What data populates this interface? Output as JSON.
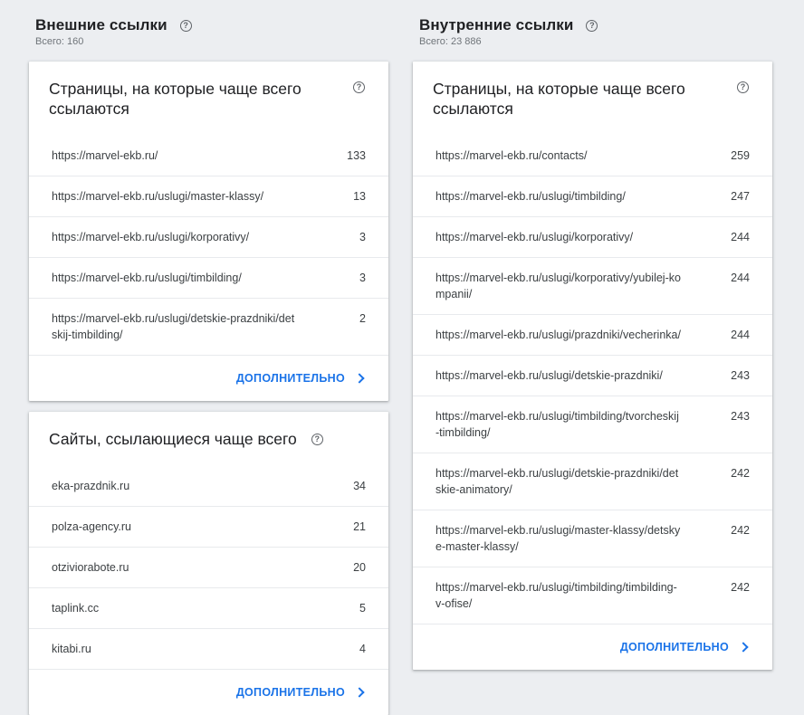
{
  "external": {
    "title": "Внешние ссылки",
    "total": "Всего: 160",
    "top_pages": {
      "title": "Страницы, на которые чаще всего ссылаются",
      "rows": [
        {
          "url": "https://marvel-ekb.ru/",
          "count": "133"
        },
        {
          "url": "https://marvel-ekb.ru/uslugi/master-klassy/",
          "count": "13"
        },
        {
          "url": "https://marvel-ekb.ru/uslugi/korporativy/",
          "count": "3"
        },
        {
          "url": "https://marvel-ekb.ru/uslugi/timbilding/",
          "count": "3"
        },
        {
          "url": "https://marvel-ekb.ru/uslugi/detskie-prazdniki/detskij-timbilding/",
          "count": "2"
        }
      ],
      "more_label": "ДОПОЛНИТЕЛЬНО"
    },
    "top_sites": {
      "title": "Сайты, ссылающиеся чаще всего",
      "rows": [
        {
          "url": "eka-prazdnik.ru",
          "count": "34"
        },
        {
          "url": "polza-agency.ru",
          "count": "21"
        },
        {
          "url": "otziviorabote.ru",
          "count": "20"
        },
        {
          "url": "taplink.cc",
          "count": "5"
        },
        {
          "url": "kitabi.ru",
          "count": "4"
        }
      ],
      "more_label": "ДОПОЛНИТЕЛЬНО"
    }
  },
  "internal": {
    "title": "Внутренние ссылки",
    "total": "Всего: 23 886",
    "top_pages": {
      "title": "Страницы, на которые чаще всего ссылаются",
      "rows": [
        {
          "url": "https://marvel-ekb.ru/contacts/",
          "count": "259"
        },
        {
          "url": "https://marvel-ekb.ru/uslugi/timbilding/",
          "count": "247"
        },
        {
          "url": "https://marvel-ekb.ru/uslugi/korporativy/",
          "count": "244"
        },
        {
          "url": "https://marvel-ekb.ru/uslugi/korporativy/yubilej-kompanii/",
          "count": "244"
        },
        {
          "url": "https://marvel-ekb.ru/uslugi/prazdniki/vecherinka/",
          "count": "244"
        },
        {
          "url": "https://marvel-ekb.ru/uslugi/detskie-prazdniki/",
          "count": "243"
        },
        {
          "url": "https://marvel-ekb.ru/uslugi/timbilding/tvorcheskij-timbilding/",
          "count": "243"
        },
        {
          "url": "https://marvel-ekb.ru/uslugi/detskie-prazdniki/detskie-animatory/",
          "count": "242"
        },
        {
          "url": "https://marvel-ekb.ru/uslugi/master-klassy/detskye-master-klassy/",
          "count": "242"
        },
        {
          "url": "https://marvel-ekb.ru/uslugi/timbilding/timbilding-v-ofise/",
          "count": "242"
        }
      ],
      "more_label": "ДОПОЛНИТЕЛЬНО"
    }
  },
  "colors": {
    "accent": "#1a73e8",
    "background": "#eceef1"
  },
  "icons": {
    "help": "help-circle-icon",
    "more": "chevron-right-icon"
  }
}
